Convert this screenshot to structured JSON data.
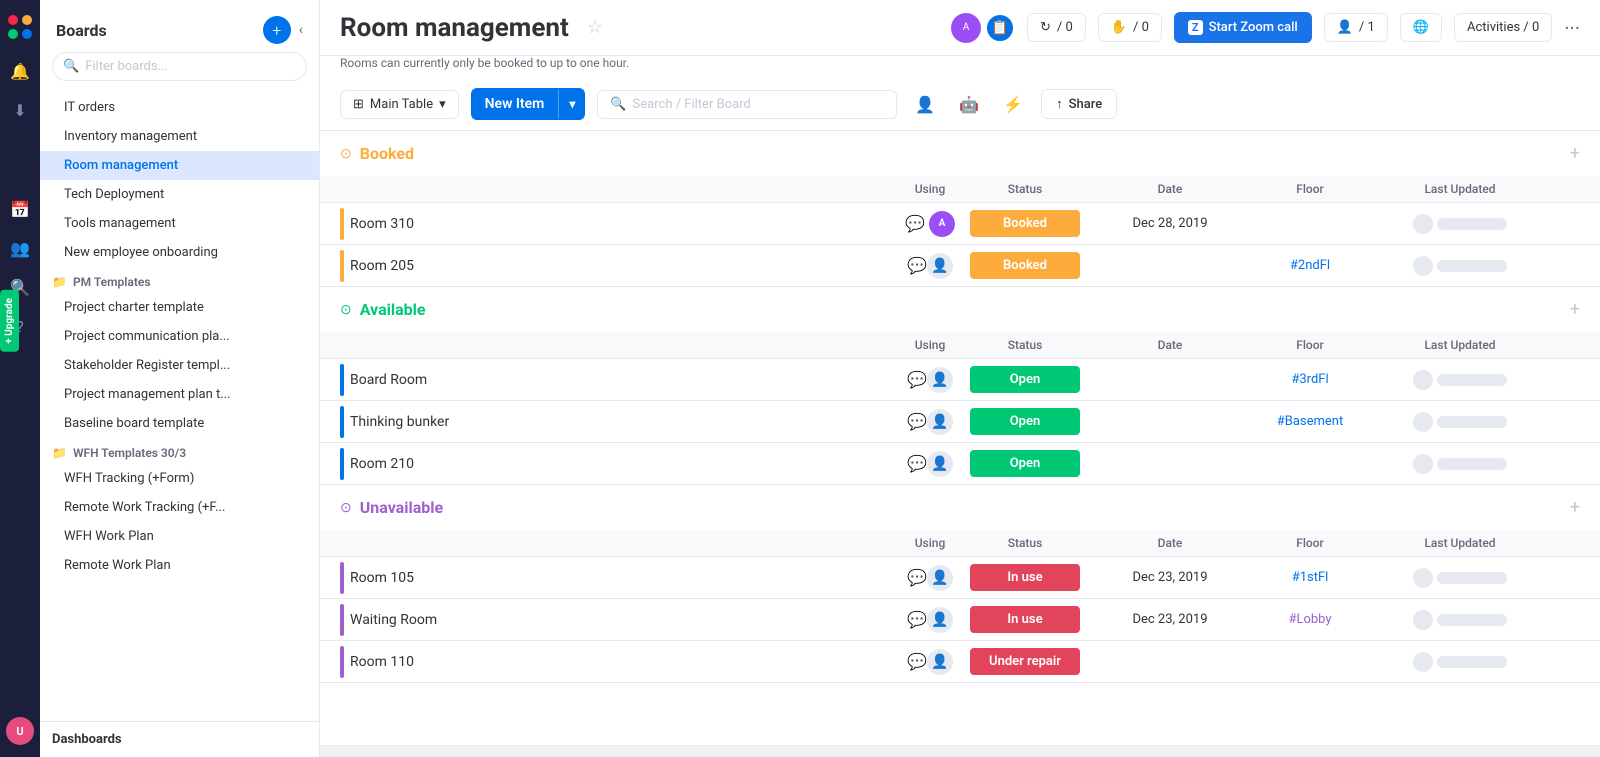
{
  "leftNav": {
    "icons": [
      "🔔",
      "⬇",
      "📅",
      "👥",
      "🔍",
      "?"
    ],
    "upgrade": "Upgrade",
    "avatar": "U"
  },
  "sidebar": {
    "title": "Boards",
    "filter_placeholder": "Filter boards...",
    "items_top": [
      {
        "id": "it-orders",
        "label": "IT orders",
        "active": false
      },
      {
        "id": "inventory",
        "label": "Inventory management",
        "active": false
      },
      {
        "id": "room-mgmt",
        "label": "Room management",
        "active": true
      },
      {
        "id": "tech-deploy",
        "label": "Tech Deployment",
        "active": false
      },
      {
        "id": "tools-mgmt",
        "label": "Tools management",
        "active": false
      },
      {
        "id": "new-employee",
        "label": "New employee onboarding",
        "active": false
      }
    ],
    "section_pm": "PM Templates",
    "items_pm": [
      {
        "id": "proj-charter",
        "label": "Project charter template"
      },
      {
        "id": "proj-comm",
        "label": "Project communication pla..."
      },
      {
        "id": "stakeholder",
        "label": "Stakeholder Register templ..."
      },
      {
        "id": "proj-mgmt",
        "label": "Project management plan t..."
      },
      {
        "id": "baseline",
        "label": "Baseline board template"
      }
    ],
    "section_wfh": "WFH Templates 30/3",
    "items_wfh": [
      {
        "id": "wfh-tracking",
        "label": "WFH Tracking (+Form)"
      },
      {
        "id": "remote-tracking",
        "label": "Remote Work Tracking (+F..."
      },
      {
        "id": "wfh-plan",
        "label": "WFH Work Plan"
      },
      {
        "id": "remote-plan",
        "label": "Remote Work Plan"
      }
    ],
    "footer": "Dashboards"
  },
  "topbar": {
    "title": "Room management",
    "subtitle": "Rooms can currently only be booked to up to one hour.",
    "activity_count": "0",
    "hand_count": "0",
    "person_count": "1",
    "activities_label": "Activities / 0",
    "zoom_label": "Start Zoom call"
  },
  "toolbar": {
    "view_label": "Main Table",
    "new_item_label": "New Item",
    "search_placeholder": "Search / Filter Board",
    "share_label": "Share"
  },
  "groups": [
    {
      "id": "booked",
      "title": "Booked",
      "color_class": "booked",
      "rows": [
        {
          "name": "Room 310",
          "status": "Booked",
          "status_class": "status-booked",
          "date": "Dec 28, 2019",
          "floor": "",
          "floor_class": "",
          "has_avatar": true
        },
        {
          "name": "Room 205",
          "status": "Booked",
          "status_class": "status-booked",
          "date": "",
          "floor": "#2ndFl",
          "floor_class": "floor-cell",
          "has_avatar": false
        }
      ]
    },
    {
      "id": "available",
      "title": "Available",
      "color_class": "available",
      "rows": [
        {
          "name": "Board Room",
          "status": "Open",
          "status_class": "status-open",
          "date": "",
          "floor": "#3rdFl",
          "floor_class": "floor-cell",
          "has_avatar": false
        },
        {
          "name": "Thinking bunker",
          "status": "Open",
          "status_class": "status-open",
          "date": "",
          "floor": "#Basement",
          "floor_class": "floor-cell",
          "has_avatar": false
        },
        {
          "name": "Room 210",
          "status": "Open",
          "status_class": "status-open",
          "date": "",
          "floor": "",
          "floor_class": "",
          "has_avatar": false
        }
      ]
    },
    {
      "id": "unavailable",
      "title": "Unavailable",
      "color_class": "unavailable",
      "rows": [
        {
          "name": "Room 105",
          "status": "In use",
          "status_class": "status-in-use",
          "date": "Dec 23, 2019",
          "floor": "#1stFl",
          "floor_class": "floor-cell",
          "has_avatar": false
        },
        {
          "name": "Waiting Room",
          "status": "In use",
          "status_class": "status-in-use",
          "date": "Dec 23, 2019",
          "floor": "#Lobby",
          "floor_class": "floor-cell purple",
          "has_avatar": false
        },
        {
          "name": "Room 110",
          "status": "Under repair",
          "status_class": "status-repair",
          "date": "",
          "floor": "",
          "floor_class": "",
          "has_avatar": false
        }
      ]
    }
  ],
  "columns": {
    "using": "Using",
    "status": "Status",
    "date": "Date",
    "floor": "Floor",
    "last_updated": "Last Updated"
  }
}
